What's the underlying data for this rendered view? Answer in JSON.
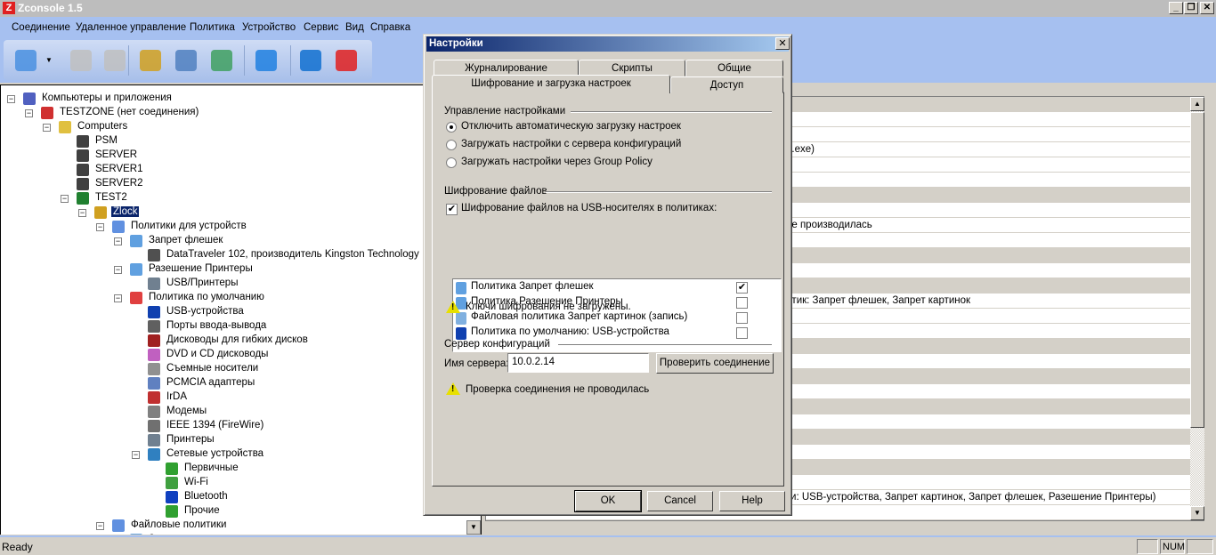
{
  "app": {
    "title": "Zconsole 1.5",
    "minimize": "_",
    "restore": "❐",
    "close": "✕"
  },
  "menu": [
    "Соединение",
    "Удаленное управление",
    "Политика",
    "Устройство",
    "Сервис",
    "Вид",
    "Справка"
  ],
  "toolbar": {
    "icons": [
      "add-computer-icon",
      "remove-computer-icon",
      "edit-computer-icon",
      "zlock-settings-icon",
      "policy-settings-icon",
      "sync-settings-icon",
      "refresh-icon",
      "help-icon",
      "zconsole-icon"
    ]
  },
  "tree": {
    "items": [
      {
        "label": "Компьютеры и приложения",
        "level": 0,
        "exp": true,
        "icon": "computers-apps-icon",
        "color": "#5060c0"
      },
      {
        "label": "TESTZONE (нет соединения)",
        "level": 1,
        "exp": true,
        "icon": "zone-disconnected-icon",
        "color": "#d03030"
      },
      {
        "label": "Computers",
        "level": 2,
        "exp": true,
        "icon": "computers-group-icon",
        "color": "#e0c040"
      },
      {
        "label": "PSM",
        "level": 3,
        "icon": "computer-icon",
        "color": "#404040"
      },
      {
        "label": "SERVER",
        "level": 3,
        "icon": "computer-icon",
        "color": "#404040"
      },
      {
        "label": "SERVER1",
        "level": 3,
        "icon": "computer-icon",
        "color": "#404040"
      },
      {
        "label": "SERVER2",
        "level": 3,
        "icon": "computer-icon",
        "color": "#404040"
      },
      {
        "label": "TEST2",
        "level": 3,
        "exp": true,
        "icon": "computer-connected-icon",
        "color": "#208030"
      },
      {
        "label": "Zlock",
        "level": 4,
        "exp": true,
        "icon": "zlock-shield-icon",
        "color": "#d0a020",
        "selected": true
      },
      {
        "label": "Политики для устройств",
        "level": 5,
        "exp": true,
        "icon": "device-policies-icon",
        "color": "#6090e0"
      },
      {
        "label": "Запрет флешек",
        "level": 6,
        "exp": true,
        "icon": "policy-green-icon",
        "color": "#60a0e0"
      },
      {
        "label": "DataTraveler 102, производитель Kingston Technology",
        "level": 7,
        "icon": "usb-drive-icon",
        "color": "#505050"
      },
      {
        "label": "Разешение Принтеры",
        "level": 6,
        "exp": true,
        "icon": "policy-red-icon",
        "color": "#60a0e0"
      },
      {
        "label": "USB/Принтеры",
        "level": 7,
        "icon": "printer-icon",
        "color": "#708090"
      },
      {
        "label": "Политика по умолчанию",
        "level": 6,
        "exp": true,
        "icon": "default-policy-icon",
        "color": "#e04040"
      },
      {
        "label": "USB-устройства",
        "level": 7,
        "icon": "usb-icon",
        "color": "#1040b0"
      },
      {
        "label": "Порты ввода-вывода",
        "level": 7,
        "icon": "ports-icon",
        "color": "#606060"
      },
      {
        "label": "Дисководы для гибких дисков",
        "level": 7,
        "icon": "floppy-icon",
        "color": "#a02020"
      },
      {
        "label": "DVD и CD дисководы",
        "level": 7,
        "icon": "dvd-icon",
        "color": "#c060c0"
      },
      {
        "label": "Съемные носители",
        "level": 7,
        "icon": "removable-media-icon",
        "color": "#909090"
      },
      {
        "label": "PCMCIA адаптеры",
        "level": 7,
        "icon": "pcmcia-icon",
        "color": "#6080c0"
      },
      {
        "label": "IrDA",
        "level": 7,
        "icon": "irda-icon",
        "color": "#c03030"
      },
      {
        "label": "Модемы",
        "level": 7,
        "icon": "modem-icon",
        "color": "#808080"
      },
      {
        "label": "IEEE 1394 (FireWire)",
        "level": 7,
        "icon": "firewire-icon",
        "color": "#707070"
      },
      {
        "label": "Принтеры",
        "level": 7,
        "icon": "printer-icon",
        "color": "#708090"
      },
      {
        "label": "Сетевые устройства",
        "level": 7,
        "exp": true,
        "icon": "network-icon",
        "color": "#3080c0"
      },
      {
        "label": "Первичные",
        "level": 8,
        "icon": "network-card-icon",
        "color": "#30a030"
      },
      {
        "label": "Wi-Fi",
        "level": 8,
        "icon": "wifi-icon",
        "color": "#40a040"
      },
      {
        "label": "Bluetooth",
        "level": 8,
        "icon": "bluetooth-icon",
        "color": "#1040c0"
      },
      {
        "label": "Прочие",
        "level": 8,
        "icon": "other-network-icon",
        "color": "#30a030"
      },
      {
        "label": "Файловые политики",
        "level": 5,
        "exp": true,
        "icon": "file-policies-icon",
        "color": "#6090e0"
      },
      {
        "label": "Запрет картинок",
        "level": 6,
        "icon": "policy-icon",
        "color": "#60a0e0"
      }
    ]
  },
  "list": {
    "rows": [
      {
        "g": true,
        "t": ""
      },
      {
        "t": ""
      },
      {
        "t": ""
      },
      {
        "t": "p.exe)"
      },
      {
        "t": ""
      },
      {
        "t": ""
      },
      {
        "g": true,
        "t": ""
      },
      {
        "t": ""
      },
      {
        "t": "не производилась"
      },
      {
        "t": ""
      },
      {
        "g": true,
        "t": ""
      },
      {
        "t": ""
      },
      {
        "g": true,
        "t": ""
      },
      {
        "t": "итик: Запрет флешек, Запрет картинок"
      },
      {
        "t": ""
      },
      {
        "t": ""
      },
      {
        "g": true,
        "t": ""
      },
      {
        "t": ""
      },
      {
        "g": true,
        "t": ""
      },
      {
        "t": ""
      },
      {
        "g": true,
        "t": ""
      },
      {
        "t": ""
      },
      {
        "g": true,
        "t": ""
      },
      {
        "t": ""
      },
      {
        "g": true,
        "t": ""
      },
      {
        "t": ""
      },
      {
        "t": "ки: USB-устройства, Запрет картинок, Запрет флешек, Разешение Принтеры)"
      },
      {
        "t": ""
      }
    ],
    "scroll_up": "▲",
    "scroll_down": "▼"
  },
  "status": {
    "text": "Ready",
    "num": "NUM"
  },
  "dialog": {
    "title": "Настройки",
    "close": "✕",
    "tabs_row1": [
      "Журналирование",
      "Скрипты",
      "Общие"
    ],
    "tabs_row2": [
      "Шифрование и загрузка настроек",
      "Доступ"
    ],
    "active_tab": "Шифрование и загрузка настроек",
    "settings_group": "Управление настройками",
    "radios": [
      {
        "label": "Отключить автоматическую загрузку настроек",
        "checked": true
      },
      {
        "label": "Загружать настройки с сервера конфигураций",
        "checked": false
      },
      {
        "label": "Загружать настройки через Group Policy",
        "checked": false
      }
    ],
    "encryption_group": "Шифрование файлов",
    "encryption_checkbox": {
      "label": "Шифрование файлов на USB-носителях в политиках:",
      "checked": true
    },
    "policies": [
      {
        "label": "Политика Запрет флешек",
        "checked": true,
        "icon": "policy-green-icon",
        "color": "#60a0e0"
      },
      {
        "label": "Политика Разешение Принтеры",
        "checked": false,
        "icon": "policy-red-icon",
        "color": "#60a0e0"
      },
      {
        "label": "Файловая политика Запрет картинок (запись)",
        "checked": false,
        "icon": "file-policy-icon",
        "color": "#80b0e0"
      },
      {
        "label": "Политика по умолчанию: USB-устройства",
        "checked": false,
        "icon": "usb-icon",
        "color": "#1040b0"
      }
    ],
    "keys_warning": "Ключи шифрования не загружены.",
    "server_group": "Сервер конфигураций",
    "server_label": "Имя сервера:",
    "server_value": "10.0.2.14",
    "check_button": "Проверить соединение",
    "check_warning": "Проверка соединения не проводилась",
    "ok": "OK",
    "cancel": "Cancel",
    "help": "Help"
  }
}
